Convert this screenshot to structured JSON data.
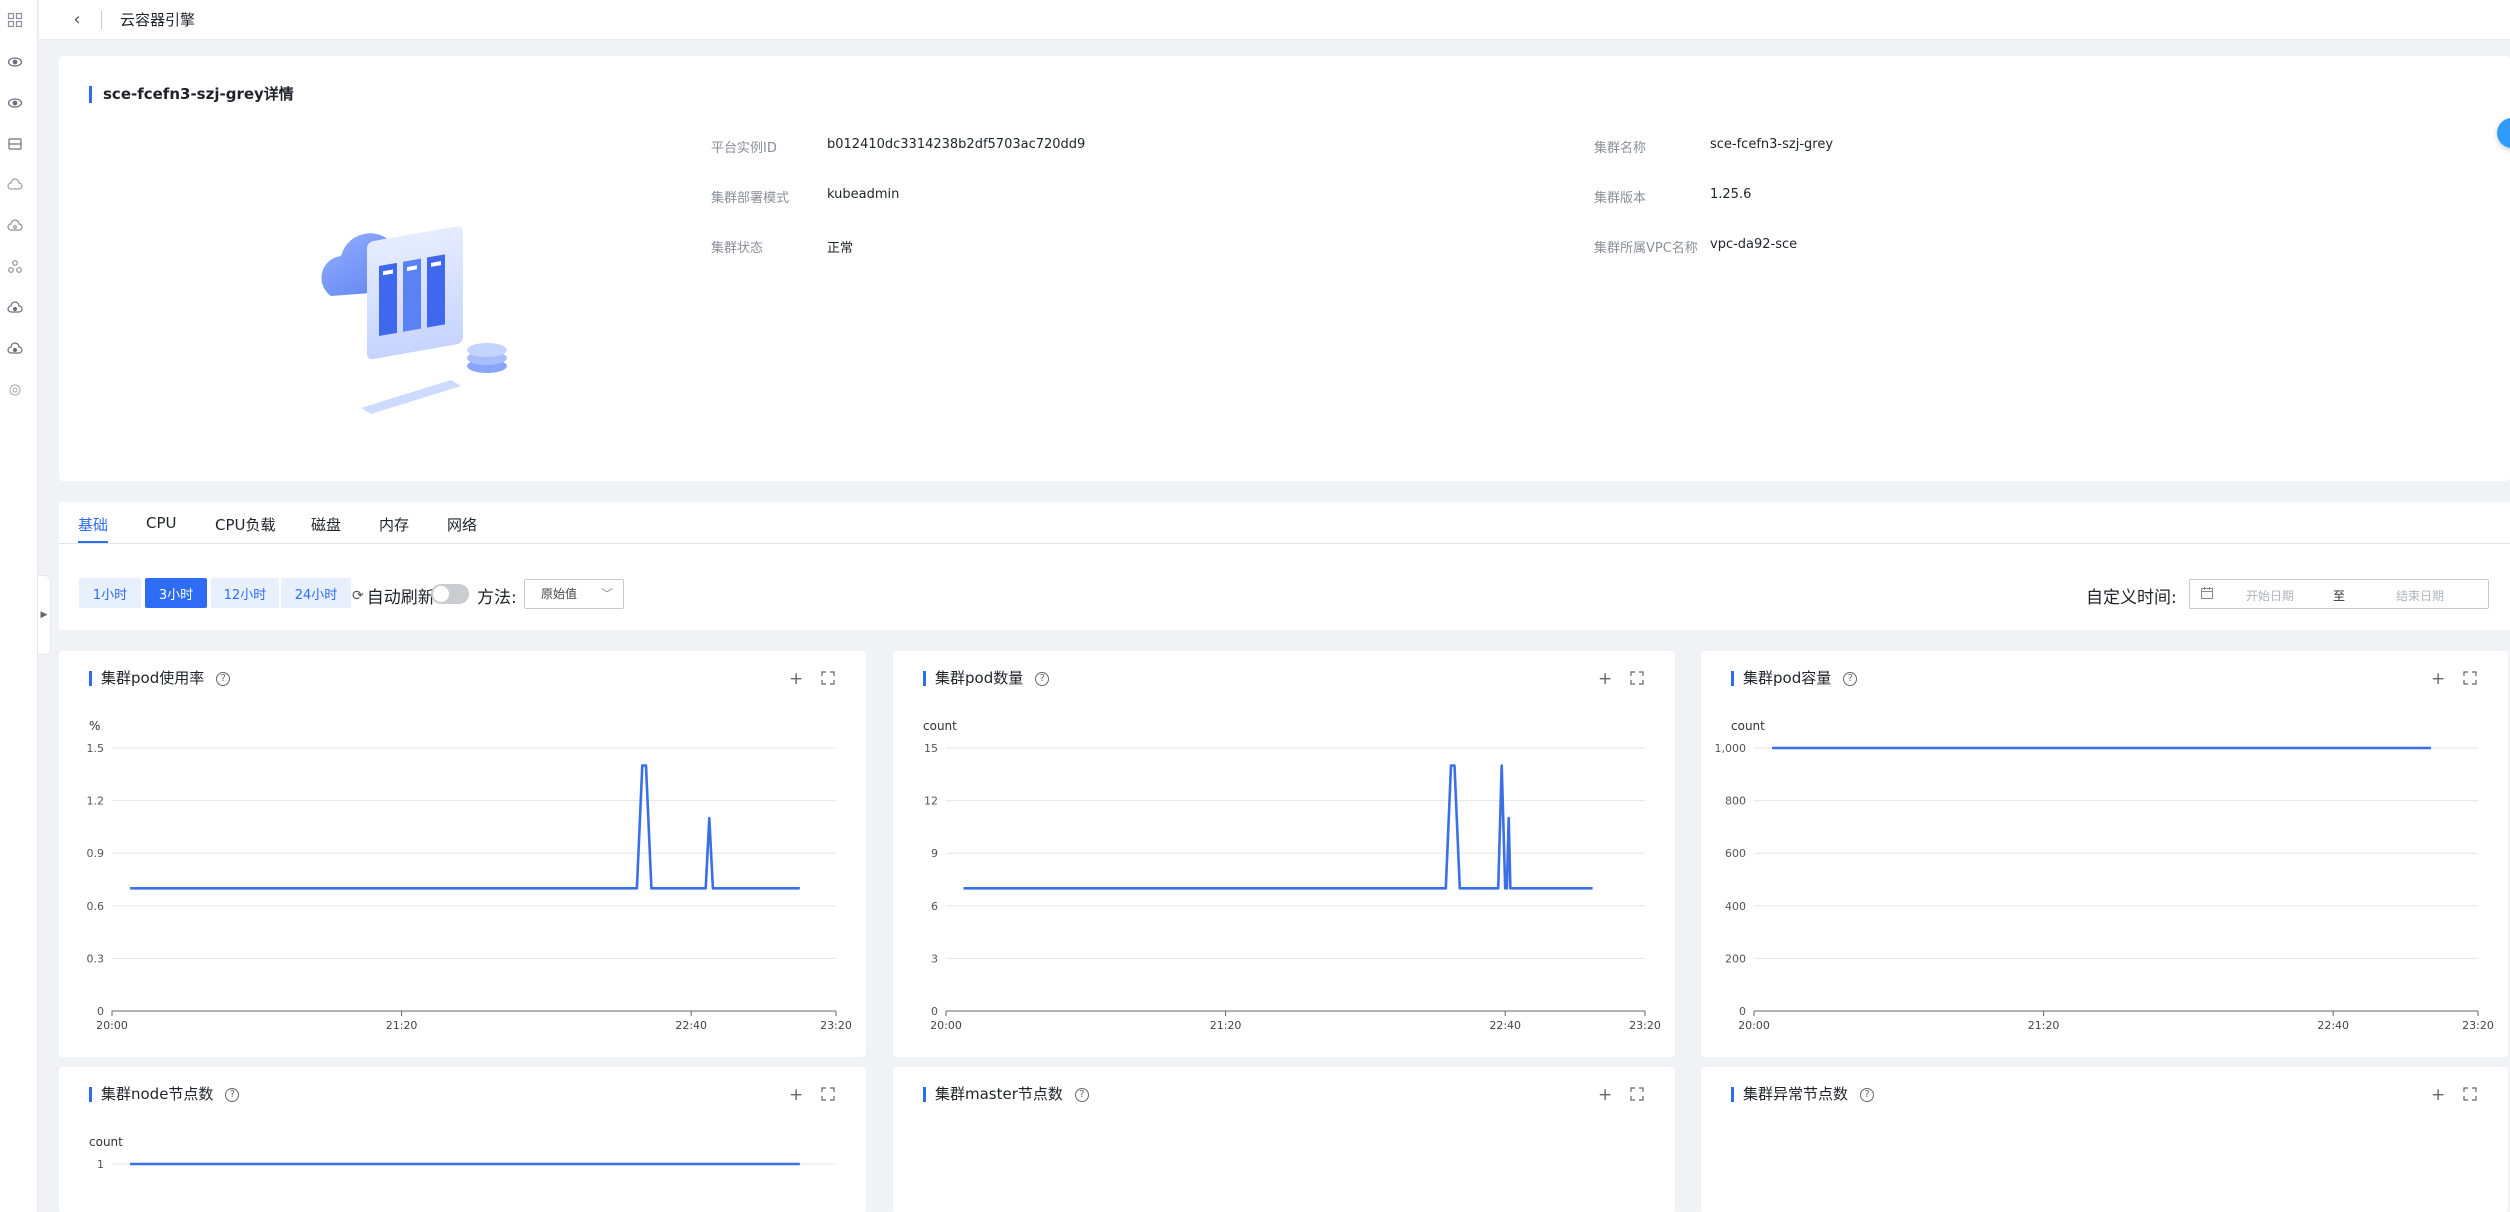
{
  "header": {
    "title": "云容器引擎"
  },
  "detail": {
    "title": "sce-fcefn3-szj-grey详情",
    "fields_left": [
      {
        "label": "平台实例ID",
        "value": "b012410dc3314238b2df5703ac720dd9"
      },
      {
        "label": "集群部署模式",
        "value": "kubeadmin"
      },
      {
        "label": "集群状态",
        "value": "正常"
      }
    ],
    "fields_right": [
      {
        "label": "集群名称",
        "value": "sce-fcefn3-szj-grey"
      },
      {
        "label": "集群版本",
        "value": "1.25.6"
      },
      {
        "label": "集群所属VPC名称",
        "value": "vpc-da92-sce"
      }
    ]
  },
  "tabs": [
    "基础",
    "CPU",
    "CPU负载",
    "磁盘",
    "内存",
    "网络"
  ],
  "filters": {
    "time_buttons": [
      "1小时",
      "3小时",
      "12小时",
      "24小时"
    ],
    "active_time": "3小时",
    "auto_refresh": "自动刷新",
    "method_label": "方法:",
    "method_value": "原始值",
    "custom_time_label": "自定义时间:",
    "start_placeholder": "开始日期",
    "range_sep": "至",
    "end_placeholder": "结束日期"
  },
  "colors": {
    "accent": "#2f6cf6",
    "series": "#3b6fe6"
  },
  "chart_data": [
    {
      "type": "line",
      "title": "集群pod使用率",
      "ylabel": "%",
      "yticks": [
        "0",
        "0.3",
        "0.6",
        "0.9",
        "1.2",
        "1.5"
      ],
      "ylim": [
        0,
        1.5
      ],
      "xticks": [
        "20:00",
        "21:20",
        "22:40",
        "23:20"
      ],
      "xlim_minutes": [
        0,
        200
      ],
      "series": [
        {
          "points": [
            [
              5,
              0.7
            ],
            [
              145,
              0.7
            ],
            [
              146.5,
              1.4
            ],
            [
              147.5,
              1.4
            ],
            [
              149,
              0.7
            ],
            [
              164,
              0.7
            ],
            [
              165,
              1.1
            ],
            [
              166,
              0.7
            ],
            [
              190,
              0.7
            ]
          ]
        }
      ]
    },
    {
      "type": "line",
      "title": "集群pod数量",
      "ylabel": "count",
      "yticks": [
        "0",
        "3",
        "6",
        "9",
        "12",
        "15"
      ],
      "ylim": [
        0,
        15
      ],
      "xticks": [
        "20:00",
        "21:20",
        "22:40",
        "23:20"
      ],
      "xlim_minutes": [
        0,
        200
      ],
      "series": [
        {
          "points": [
            [
              5,
              7
            ],
            [
              143,
              7
            ],
            [
              144.5,
              14
            ],
            [
              145.5,
              14
            ],
            [
              147,
              7
            ],
            [
              158,
              7
            ],
            [
              159,
              14
            ],
            [
              160,
              7
            ],
            [
              160.5,
              7
            ],
            [
              161,
              11
            ],
            [
              161.5,
              7
            ],
            [
              185,
              7
            ]
          ]
        }
      ]
    },
    {
      "type": "line",
      "title": "集群pod容量",
      "ylabel": "count",
      "yticks": [
        "0",
        "200",
        "400",
        "600",
        "800",
        "1,000"
      ],
      "ylim": [
        0,
        1000
      ],
      "xticks": [
        "20:00",
        "21:20",
        "22:40",
        "23:20"
      ],
      "xlim_minutes": [
        0,
        200
      ],
      "series": [
        {
          "points": [
            [
              5,
              1000
            ],
            [
              187,
              1000
            ]
          ]
        }
      ]
    },
    {
      "type": "line",
      "title": "集群node节点数",
      "ylabel": "count",
      "yticks": [
        "1"
      ],
      "ylim": [
        0,
        1
      ],
      "xticks": [],
      "xlim_minutes": [
        0,
        200
      ],
      "series": [
        {
          "points": [
            [
              5,
              1
            ],
            [
              190,
              1
            ]
          ]
        }
      ]
    },
    {
      "type": "line",
      "title": "集群master节点数",
      "ylabel": "",
      "yticks": [],
      "xticks": [],
      "series": []
    },
    {
      "type": "line",
      "title": "集群异常节点数",
      "ylabel": "",
      "yticks": [],
      "xticks": [],
      "series": []
    }
  ]
}
